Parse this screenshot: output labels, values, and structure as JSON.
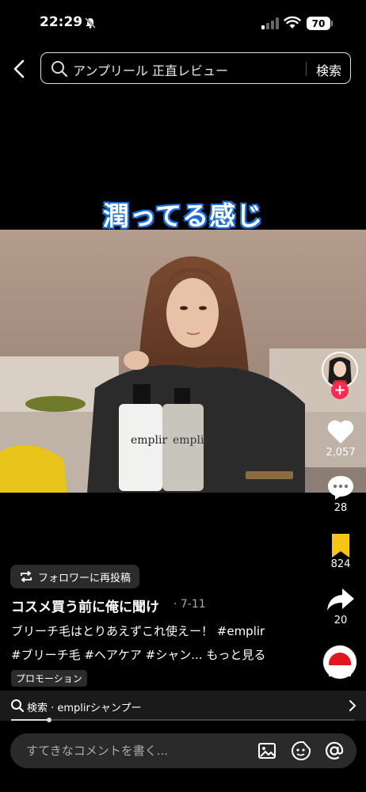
{
  "status_bar": {
    "time": "22:29",
    "battery": "70"
  },
  "search": {
    "query": "アンプリール 正直レビュー",
    "button_label": "検索"
  },
  "video": {
    "overlay_caption": "潤ってる感じ",
    "bottle_label": "emplir"
  },
  "rail": {
    "likes": "2,057",
    "comments": "28",
    "saves": "824",
    "shares": "20"
  },
  "post": {
    "repost_label": "フォロワーに再投稿",
    "author": "コスメ買う前に俺に聞け",
    "date": "· 7-11",
    "desc_line1": "ブリーチ毛はとりあえずこれ使えー！ #emplir",
    "desc_line2": "#ブリーチ毛 #ヘアケア #シャン... ",
    "more_label": "もっと見る",
    "promo_label": "プロモーション"
  },
  "suggestion": {
    "text": "検索 · emplirシャンプー"
  },
  "playback": {
    "progress": 0.11
  },
  "comment": {
    "placeholder": "すてきなコメントを書く..."
  },
  "colors": {
    "accent": "#fe2c55",
    "save": "#f5c518",
    "caption_outline": "#1d6fd8"
  }
}
